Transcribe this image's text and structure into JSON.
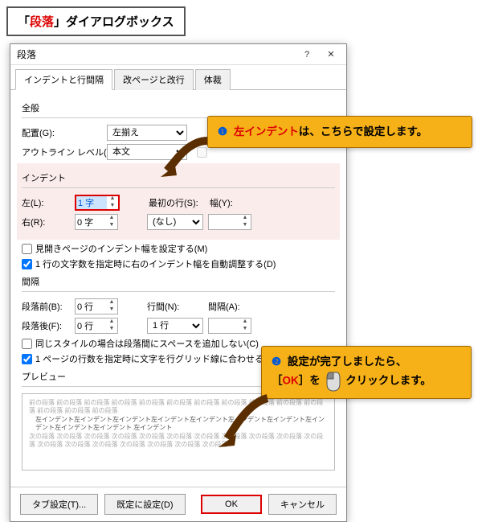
{
  "caption": {
    "prefix": "「",
    "highlight": "段落",
    "suffix": "」ダイアログボックス"
  },
  "dialog": {
    "title": "段落"
  },
  "tabs": [
    "インデントと行間隔",
    "改ページと改行",
    "体裁"
  ],
  "general": {
    "section": "全般",
    "align_label": "配置(G):",
    "align_value": "左揃え",
    "outline_label": "アウトライン レベル(O):",
    "outline_value": "本文"
  },
  "indent": {
    "section": "インデント",
    "left_label": "左(L):",
    "left_value": "1 字",
    "right_label": "右(R):",
    "right_value": "0 字",
    "first_label": "最初の行(S):",
    "first_value": "(なし)",
    "width_label": "幅(Y):",
    "width_value": "",
    "chk1": "見開きページのインデント幅を設定する(M)",
    "chk2": "1 行の文字数を指定時に右のインデント幅を自動調整する(D)"
  },
  "spacing": {
    "section": "間隔",
    "before_label": "段落前(B):",
    "before_value": "0 行",
    "after_label": "段落後(F):",
    "after_value": "0 行",
    "line_label": "行間(N):",
    "line_value": "1 行",
    "gap_label": "間隔(A):",
    "gap_value": "",
    "chk1": "同じスタイルの場合は段落間にスペースを追加しない(C)",
    "chk2": "1 ページの行数を指定時に文字を行グリッド線に合わせる(W)"
  },
  "preview": {
    "label": "プレビュー",
    "prev_text": "前の段落 前の段落 前の段落 前の段落 前の段落 前の段落 前の段落 前の段落 前の段落 前の段落 前の段落 前の段落 前の段落 前の段落",
    "sample_text": "左インデント左インデント左インデント左インデント左インデント左インデント左インデント左インデント左インデント左インデント 左インデント",
    "next_text": "次の段落 次の段落 次の段落 次の段落 次の段落 次の段落 次の段落 次の段落 次の段落 次の段落 次の段落 次の段落 次の段落 次の段落 次の段落 次の段落 次の段落 次の段落"
  },
  "buttons": {
    "tabsettings": "タブ設定(T)...",
    "default": "既定に設定(D)",
    "ok": "OK",
    "cancel": "キャンセル"
  },
  "callout1": {
    "num": "❶",
    "highlight": "左インデント",
    "rest": "は、こちらで設定します。"
  },
  "callout2": {
    "num": "❷",
    "line1": "設定が完了しましたら、",
    "ok_open": "［",
    "ok": "OK",
    "ok_close": "］",
    "rest1": "を",
    "rest2": "クリックします。"
  }
}
